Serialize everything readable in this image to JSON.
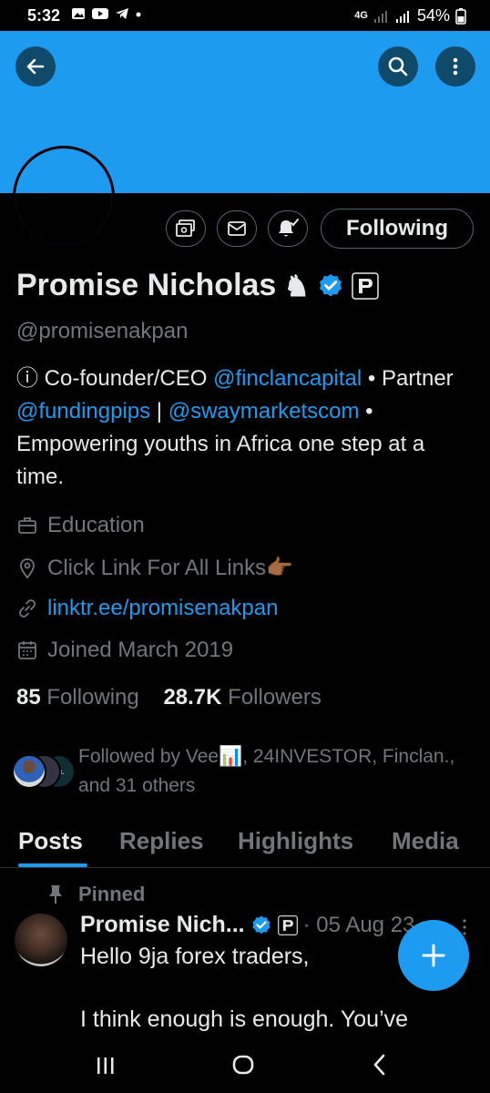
{
  "status_bar": {
    "time": "5:32",
    "network": "4G",
    "battery": "54%"
  },
  "profile": {
    "name": "Promise Nicholas",
    "handle": "@promisenakpan",
    "follow_button": "Following",
    "bio": {
      "p1": "ⓘ Co-founder/CEO ",
      "m1": "@finclancapital",
      "p2": " • Partner ",
      "m2": "@fundingpips",
      "p3": " | ",
      "m3": "@swaymarketscom",
      "p4": " • Empowering youths in Africa one step at a time."
    },
    "category": "Education",
    "location": "Click Link For All Links👉🏾",
    "website": "linktr.ee/promisenakpan",
    "joined": "Joined March 2019",
    "following_count": "85",
    "following_label": "Following",
    "followers_count": "28.7K",
    "followers_label": "Followers",
    "followed_by": "Followed by Vee📊, 24INVESTOR, Finclan., and 31 others"
  },
  "tabs": [
    "Posts",
    "Replies",
    "Highlights",
    "Media"
  ],
  "tweet": {
    "pinned_label": "Pinned",
    "author": "Promise Nich...",
    "date": "· 05 Aug 23",
    "line1": "Hello 9ja forex traders,",
    "line2": "I think enough is enough. You’ve"
  },
  "colors": {
    "accent": "#1d9bf0",
    "background": "#000000",
    "muted": "#71767b"
  }
}
